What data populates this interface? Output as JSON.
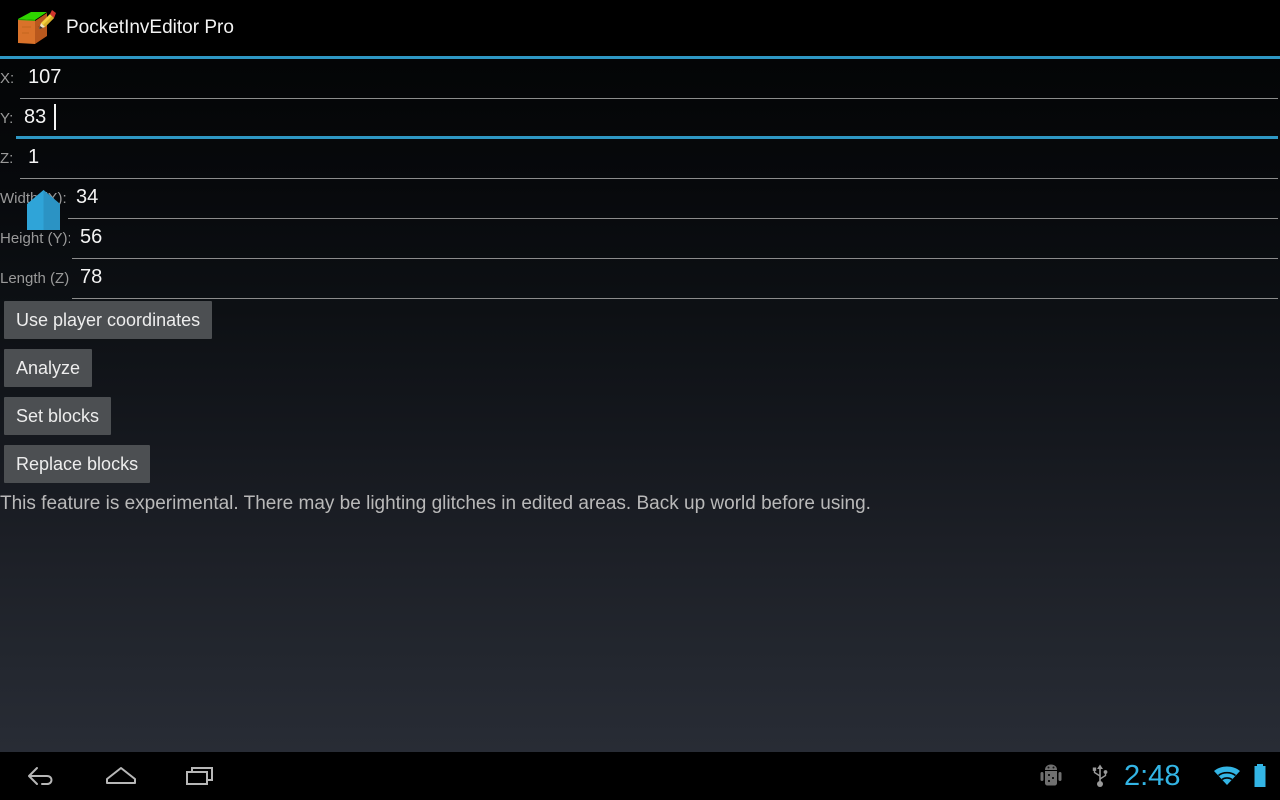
{
  "app": {
    "title": "PocketInvEditor Pro",
    "icon": "block-pencil-icon",
    "accent_color": "#2e97c4"
  },
  "form": {
    "coordinate_fields": [
      {
        "label": "X:",
        "value": "107",
        "focused": false
      },
      {
        "label": "Y:",
        "value": "83",
        "focused": true
      },
      {
        "label": "Z:",
        "value": "1",
        "focused": false
      }
    ],
    "size_fields": [
      {
        "label": "Width (X):",
        "value": "34",
        "focused": false
      },
      {
        "label": "Height (Y):",
        "value": "56",
        "focused": false
      },
      {
        "label": "Length (Z):",
        "value": "78",
        "focused": false
      }
    ]
  },
  "buttons": [
    {
      "label": "Use player coordinates",
      "name": "use-player-coordinates-button"
    },
    {
      "label": "Analyze",
      "name": "analyze-button"
    },
    {
      "label": "Set blocks",
      "name": "set-blocks-button"
    },
    {
      "label": "Replace blocks",
      "name": "replace-blocks-button"
    }
  ],
  "warning": "This feature is experimental. There may be lighting glitches in edited areas. Back up world before using.",
  "navbar": {
    "back": "back-icon",
    "home": "home-icon",
    "recents": "recent-apps-icon"
  },
  "statusbar": {
    "debug_icon": "android-debug-icon",
    "usb_icon": "usb-icon",
    "clock": "2:48",
    "wifi_icon": "wifi-icon",
    "battery_icon": "battery-full-icon",
    "clock_color": "#33b5e5"
  }
}
